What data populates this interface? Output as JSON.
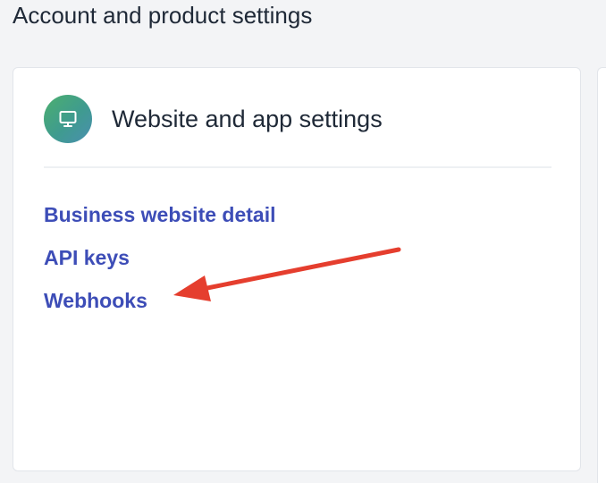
{
  "page": {
    "section_title": "Account and product settings"
  },
  "card": {
    "title": "Website and app settings",
    "icon": "monitor-icon",
    "links": [
      {
        "label": "Business website detail"
      },
      {
        "label": "API keys"
      },
      {
        "label": "Webhooks"
      }
    ]
  },
  "annotation": {
    "icon": "red-arrow-icon",
    "color": "#e53e2e"
  },
  "colors": {
    "link": "#3d4db7",
    "icon_gradient_start": "#4caf6e",
    "icon_gradient_end": "#4a8fb0"
  }
}
